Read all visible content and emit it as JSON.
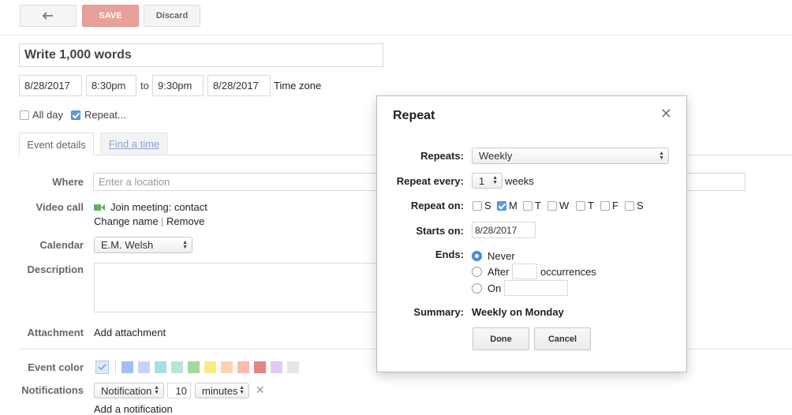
{
  "toolbar": {
    "save_label": "SAVE",
    "discard_label": "Discard"
  },
  "event": {
    "title": "Write 1,000 words",
    "start_date": "8/28/2017",
    "start_time": "8:30pm",
    "to_label": "to",
    "end_time": "9:30pm",
    "end_date": "8/28/2017",
    "timezone_link": "Time zone",
    "all_day_label": "All day",
    "repeat_label": "Repeat..."
  },
  "tabs": [
    {
      "label": "Event details"
    },
    {
      "label": "Find a time"
    }
  ],
  "details": {
    "where_label": "Where",
    "where_placeholder": "Enter a location",
    "video_call_label": "Video call",
    "join_meeting": "Join meeting: contact",
    "change_name": "Change name",
    "separator": "|",
    "remove": "Remove",
    "calendar_label": "Calendar",
    "calendar_value": "E.M. Welsh",
    "description_label": "Description",
    "attachment_label": "Attachment",
    "add_attachment": "Add attachment",
    "event_color_label": "Event color",
    "notifications_label": "Notifications",
    "notification_type": "Notification",
    "notification_amount": "10",
    "notification_unit": "minutes",
    "add_notification": "Add a notification"
  },
  "colors": {
    "accent": "#5a84cc",
    "save_bg": "#e8a09a",
    "swatches": [
      "#a4bdfc",
      "#c9d3f8",
      "#9fe1e7",
      "#b8e6d2",
      "#7bd148",
      "#fbe983",
      "#ffd3a8",
      "#ffb8ac",
      "#e78383",
      "#e5c7f5",
      "#e6e6e6"
    ]
  },
  "dialog": {
    "title": "Repeat",
    "repeats_label": "Repeats:",
    "repeats_value": "Weekly",
    "repeat_every_label": "Repeat every:",
    "repeat_every_value": "1",
    "repeat_every_unit": "weeks",
    "repeat_on_label": "Repeat on:",
    "days": [
      {
        "label": "S",
        "checked": false
      },
      {
        "label": "M",
        "checked": true
      },
      {
        "label": "T",
        "checked": false
      },
      {
        "label": "W",
        "checked": false
      },
      {
        "label": "T",
        "checked": false
      },
      {
        "label": "F",
        "checked": false
      },
      {
        "label": "S",
        "checked": false
      }
    ],
    "starts_on_label": "Starts on:",
    "starts_on_value": "8/28/2017",
    "ends_label": "Ends:",
    "ends_never": "Never",
    "ends_after": "After",
    "ends_occurrences": "occurrences",
    "ends_on": "On",
    "summary_label": "Summary:",
    "summary_value": "Weekly on Monday",
    "done_label": "Done",
    "cancel_label": "Cancel"
  }
}
